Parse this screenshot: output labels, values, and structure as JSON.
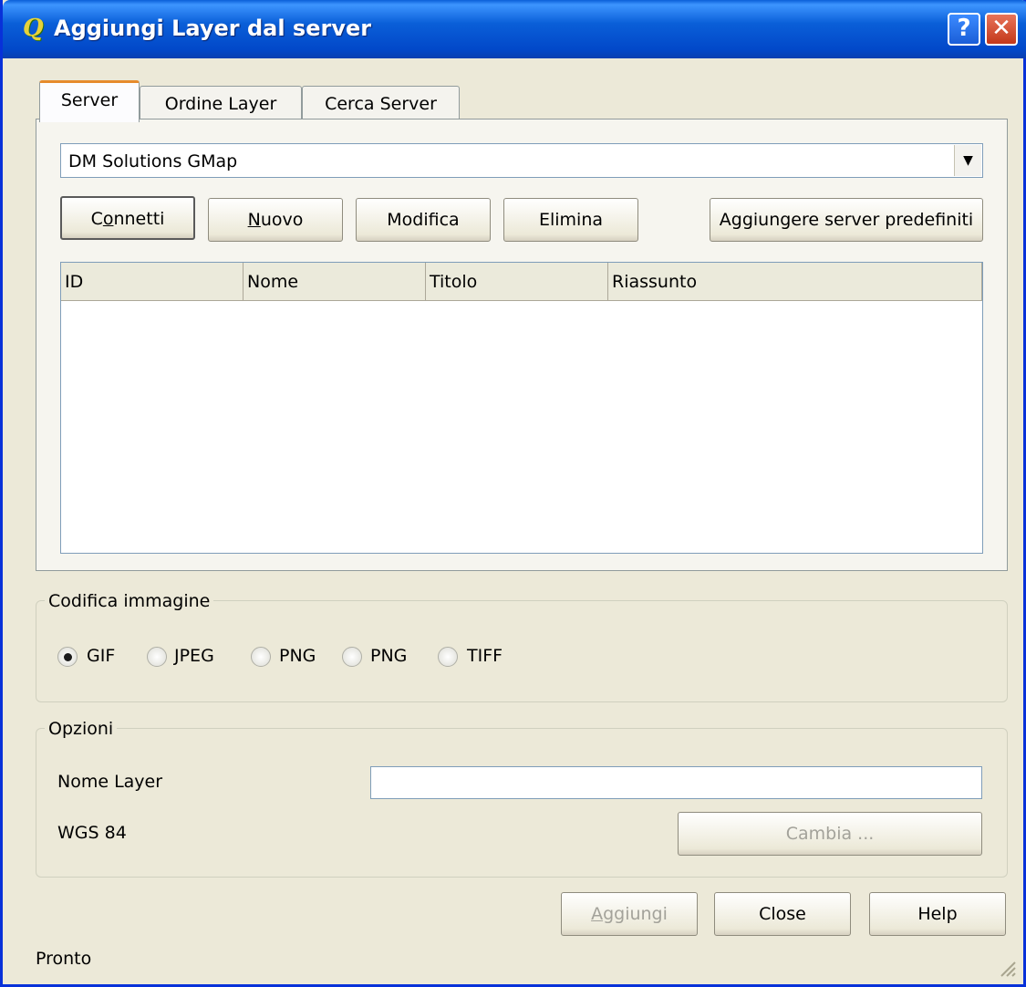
{
  "window": {
    "title": "Aggiungi Layer dal server",
    "app_icon_glyph": "Q",
    "help_glyph": "?",
    "close_glyph": "✕"
  },
  "tabs": [
    {
      "label": "Server"
    },
    {
      "label": "Ordine Layer"
    },
    {
      "label": "Cerca Server"
    }
  ],
  "server": {
    "selected": "DM Solutions GMap",
    "arrow_glyph": "▼",
    "buttons": {
      "connect": {
        "pre": "C",
        "ul": "o",
        "post": "nnetti"
      },
      "new": {
        "pre": "",
        "ul": "N",
        "post": "uovo"
      },
      "edit": "Modifica",
      "delete": "Elimina",
      "add_defaults": "Aggiungere server predefiniti"
    },
    "table": {
      "columns": [
        "ID",
        "Nome",
        "Titolo",
        "Riassunto"
      ]
    }
  },
  "encoding": {
    "title": "Codifica immagine",
    "options": [
      {
        "label": "GIF",
        "checked": true
      },
      {
        "label": "JPEG",
        "checked": false
      },
      {
        "label": "PNG",
        "checked": false
      },
      {
        "label": "PNG",
        "checked": false
      },
      {
        "label": "TIFF",
        "checked": false
      }
    ]
  },
  "options": {
    "title": "Opzioni",
    "layer_name_label": "Nome Layer",
    "layer_name_value": "",
    "crs_label": "WGS 84",
    "change_button": "Cambia ..."
  },
  "footer": {
    "add": {
      "pre": "",
      "ul": "A",
      "post": "ggiungi"
    },
    "close": "Close",
    "help": "Help"
  },
  "status": "Pronto"
}
